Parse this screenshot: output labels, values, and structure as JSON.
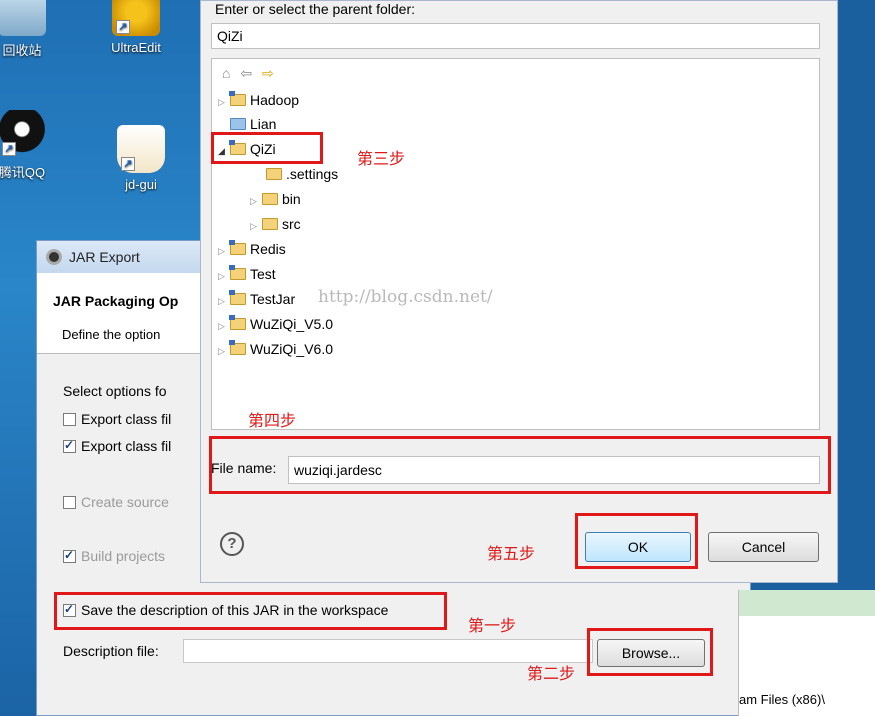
{
  "desktop": {
    "icons": [
      {
        "label": "回收站"
      },
      {
        "label": "UltraEdit"
      },
      {
        "label": "腾讯QQ"
      },
      {
        "label": "jd-gui"
      }
    ]
  },
  "jar_export": {
    "window_title": "JAR Export",
    "heading": "JAR Packaging Op",
    "subheading": "Define the option",
    "select_options_label": "Select options fo",
    "export_class_files_1": "Export class fil",
    "export_class_files_2": "Export class fil",
    "create_source": "Create source",
    "build_projects": "Build projects",
    "save_description": "Save the description of this JAR in the workspace",
    "description_file_label": "Description file:",
    "description_file_value": "",
    "browse_button": "Browse...",
    "strip_text": "am Files (x86)\\"
  },
  "folder_dialog": {
    "prompt": "Enter or select the parent folder:",
    "parent_folder_value": "QiZi",
    "tree_items": [
      "Hadoop",
      "Lian",
      "QiZi",
      ".settings",
      "bin",
      "src",
      "Redis",
      "Test",
      "TestJar",
      "WuZiQi_V5.0",
      "WuZiQi_V6.0"
    ],
    "watermark": "http://blog.csdn.net/",
    "file_name_label": "File name:",
    "file_name_value": "wuziqi.jardesc",
    "ok_button": "OK",
    "cancel_button": "Cancel",
    "help_icon": "?"
  },
  "annotations": {
    "step1": "第一步",
    "step2": "第二步",
    "step3": "第三步",
    "step4": "第四步",
    "step5": "第五步",
    "color": "#e01818"
  }
}
